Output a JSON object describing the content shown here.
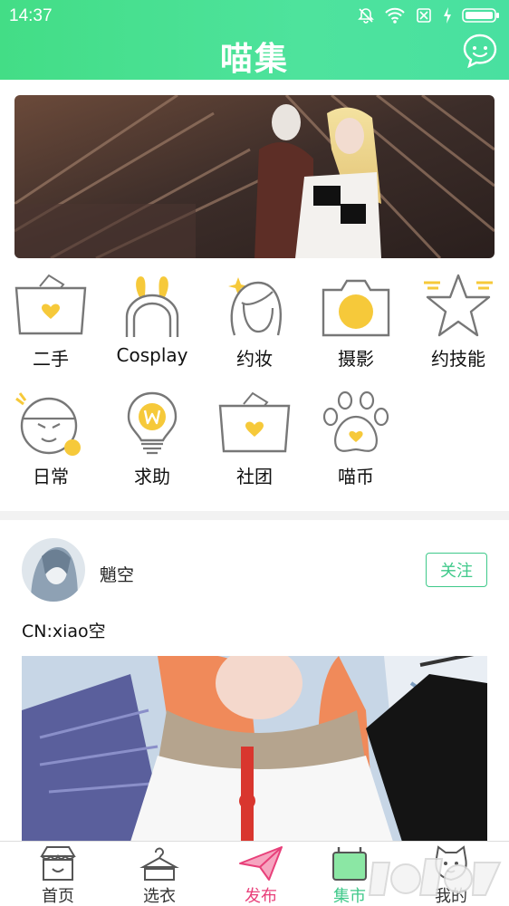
{
  "status_bar": {
    "time": "14:37"
  },
  "app_bar": {
    "title": "喵集"
  },
  "categories": [
    {
      "id": "secondhand",
      "label": "二手"
    },
    {
      "id": "cosplay",
      "label": "Cosplay"
    },
    {
      "id": "makeup",
      "label": "约妆"
    },
    {
      "id": "photo",
      "label": "摄影"
    },
    {
      "id": "skill",
      "label": "约技能"
    },
    {
      "id": "daily",
      "label": "日常"
    },
    {
      "id": "help",
      "label": "求助"
    },
    {
      "id": "club",
      "label": "社团"
    },
    {
      "id": "coin",
      "label": "喵币"
    }
  ],
  "post": {
    "username": "魈空",
    "follow_label": "关注",
    "caption": "CN:xiao空"
  },
  "bottom_nav": [
    {
      "id": "home",
      "label": "首页"
    },
    {
      "id": "outfit",
      "label": "选衣"
    },
    {
      "id": "publish",
      "label": "发布"
    },
    {
      "id": "market",
      "label": "集市"
    },
    {
      "id": "mine",
      "label": "我的"
    }
  ],
  "colors": {
    "accent": "#43dd86",
    "icon_yellow": "#f6c93a",
    "publish_pink": "#e8407a",
    "follow_green": "#3fc98a"
  }
}
